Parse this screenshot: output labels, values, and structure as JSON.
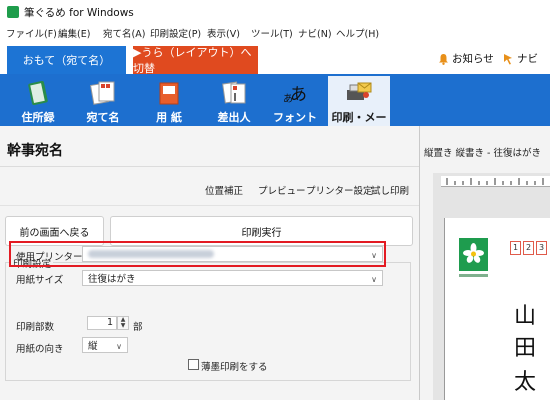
{
  "window": {
    "title": "筆ぐるめ for Windows"
  },
  "menu": [
    "ファイル(F)",
    "編集(E)",
    "宛て名(A)",
    "印刷設定(P)",
    "表示(V)",
    "ツール(T)",
    "ナビ(N)",
    "ヘルプ(H)"
  ],
  "mode_tabs": {
    "front": "おもて（宛て名）",
    "back": "▶うら（レイアウト）へ切替"
  },
  "header_links": {
    "notice": "お知らせ",
    "navi": "ナビ"
  },
  "toolbar": [
    "住所録",
    "宛て名",
    "用 紙",
    "差出人",
    "フォント",
    "印刷・メール"
  ],
  "page": {
    "title": "幹事宛名"
  },
  "sub_links": [
    "位置補正",
    "プレビュー",
    "プリンター設定",
    "試し印刷"
  ],
  "buttons": {
    "back": "前の画面へ戻る",
    "execute": "印刷実行"
  },
  "print_settings": {
    "group_label": "印刷設定",
    "printer_label": "使用プリンター",
    "paper_size_label": "用紙サイズ",
    "paper_size_value": "往復はがき",
    "copies_label": "印刷部数",
    "copies_value": "1",
    "copies_unit": "部",
    "orientation_label": "用紙の向き",
    "orientation_value": "縦",
    "light_print_label": "薄墨印刷をする"
  },
  "preview": {
    "title": "縦置き 縦書き - 往復はがき",
    "postal_digits": [
      "1",
      "2",
      "3"
    ],
    "name_chars": [
      "山",
      "田",
      "太"
    ]
  },
  "colors": {
    "front_tab": "#1d74d4",
    "back_tab": "#e04a1f",
    "toolbar": "#1d6fcf",
    "highlight": "#e31b23"
  }
}
